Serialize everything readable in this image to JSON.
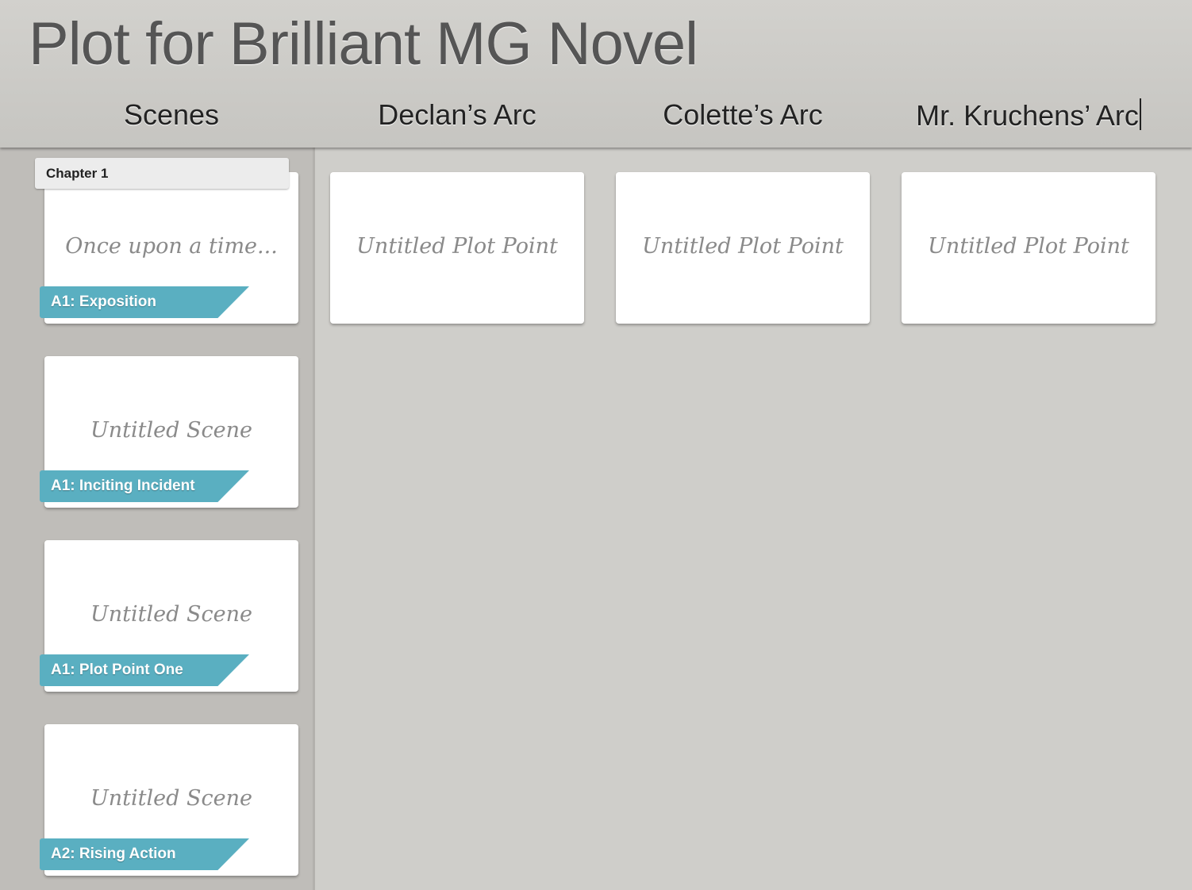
{
  "title": "Plot for Brilliant MG Novel",
  "columns": [
    {
      "label": "Scenes"
    },
    {
      "label": "Declan’s Arc"
    },
    {
      "label": "Colette’s Arc"
    },
    {
      "label": "Mr. Kruchens’ Arc"
    }
  ],
  "chapter": {
    "label": "Chapter 1"
  },
  "scenes": [
    {
      "text": "Once upon a time...",
      "tag": "A1: Exposition"
    },
    {
      "text": "Untitled Scene",
      "tag": "A1: Inciting Incident"
    },
    {
      "text": "Untitled Scene",
      "tag": "A1: Plot Point One"
    },
    {
      "text": "Untitled Scene",
      "tag": "A2: Rising Action"
    }
  ],
  "plot_points": [
    {
      "text": "Untitled Plot Point"
    },
    {
      "text": "Untitled Plot Point"
    },
    {
      "text": "Untitled Plot Point"
    }
  ],
  "colors": {
    "tag": "#5aafc1"
  }
}
